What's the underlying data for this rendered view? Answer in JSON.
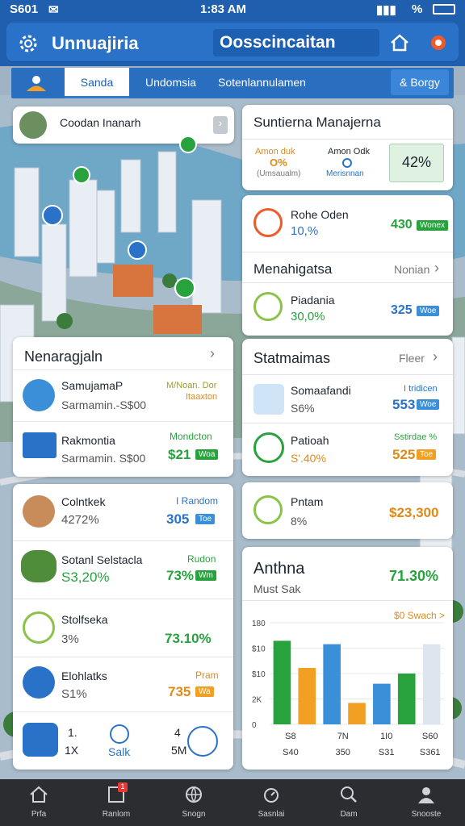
{
  "status": {
    "time_left": "S601",
    "clock": "1:83 AM",
    "percent": "%"
  },
  "app": {
    "title": "Unnuajiria",
    "search": "Oosscincaitan"
  },
  "tabs": [
    {
      "label": "Sanda",
      "active": true
    },
    {
      "label": "Undomsia"
    },
    {
      "label": "Sotenlannulamen"
    }
  ],
  "tab_button": "& Borgy",
  "map_card": {
    "label": "Coodan Inanarh"
  },
  "sistema": {
    "title": "Suntierna Manajerna",
    "left_top": "Amon duk",
    "left_mid": "O%",
    "left_sub": "(Umsaualm)",
    "mid_top": "Amon Odk",
    "mid_sub": "Merisnnan",
    "right_value": "42%"
  },
  "finance_card": {
    "row1": {
      "title": "Rohe Oden",
      "pct": "10,%",
      "value": "430",
      "badge": "Wonex"
    },
    "section": "Menahigatsa",
    "section_link": "Nonian",
    "row2": {
      "title": "Piadania",
      "pct": "30,0%",
      "value": "325",
      "badge": "Woe"
    }
  },
  "left_card1": {
    "title": "Nenaragjaln",
    "rows": [
      {
        "title": "SamujamaP",
        "sub": "Sarmamin.-S$00",
        "tag": "M/Noan. Dor",
        "tag2": "Itaaxton",
        "value": ""
      },
      {
        "title": "Rakmontia",
        "sub": "Sarmamin. S$00",
        "tag": "Mondcton",
        "value": "$21",
        "badge": "Woa"
      }
    ]
  },
  "right_card1": {
    "title": "Statmaimas",
    "link": "Fleer",
    "rows": [
      {
        "title": "Somaafandi",
        "pct": "S6%",
        "tag": "I tridicen",
        "value": "553",
        "badge": "Woe"
      },
      {
        "title": "Patioah",
        "pct": "S'.40%",
        "tag": "Sstirdae %",
        "value": "525",
        "badge": "Toe"
      }
    ]
  },
  "left_card2": {
    "rows": [
      {
        "title": "Colntkek",
        "pct": "4272%",
        "tag": "I Random",
        "value": "305",
        "badge": "Toe"
      },
      {
        "title": "Sotanl Selstacla",
        "pct": "S3,20%",
        "tag": "Rudon",
        "value": "73%",
        "badge": "Wm"
      },
      {
        "title": "Stolfseka",
        "pct": "3%",
        "value": "73.10%"
      },
      {
        "title": "Elohlatks",
        "pct": "S1%",
        "tag": "Pram",
        "value": "735",
        "badge": "Wa"
      }
    ],
    "footer": [
      {
        "top": "1.",
        "bottom": "1X"
      },
      {
        "top": "",
        "bottom": "Salk"
      },
      {
        "top": "4",
        "bottom": "5M"
      }
    ]
  },
  "mini_card": {
    "title": "Pntam",
    "pct": "8%",
    "value": "$23,300"
  },
  "chart_card": {
    "title": "Anthna",
    "subtitle": "Must Sak",
    "value": "71.30%",
    "link": "$0 Swach >"
  },
  "chart_data": {
    "type": "bar",
    "ylim": [
      0,
      180
    ],
    "ytick_labels": [
      "180",
      "$10",
      "$10",
      "2K",
      "0"
    ],
    "xtick_top": [
      "S8",
      "7N",
      "1I0",
      "S60"
    ],
    "xtick_bottom": [
      "S40",
      "350",
      "S31",
      "S361"
    ],
    "values": [
      148,
      100,
      142,
      38,
      72,
      90,
      142
    ],
    "bar_colors": [
      "#27a23d",
      "#f2a024",
      "#3a8fd8",
      "#f2a024",
      "#3a8fd8",
      "#27a23d",
      "#dde6ee"
    ]
  },
  "nav": [
    {
      "label": "Prfa",
      "icon": "home-icon"
    },
    {
      "label": "Ranlom",
      "icon": "notes-icon",
      "badge": "1"
    },
    {
      "label": "Snogn",
      "icon": "globe-icon"
    },
    {
      "label": "Sasnlai",
      "icon": "timer-icon"
    },
    {
      "label": "Dam",
      "icon": "search-icon"
    },
    {
      "label": "Snooste",
      "icon": "profile-icon"
    }
  ],
  "colors": {
    "primary": "#1f5fae",
    "green": "#27a23d",
    "orange": "#f2a024",
    "blue": "#3a8fd8"
  }
}
